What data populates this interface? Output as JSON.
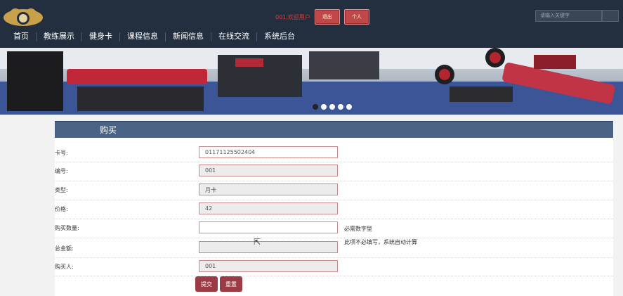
{
  "header": {
    "user_text": "001,欢迎用户",
    "btn1": "退出",
    "btn2": "个人",
    "search_placeholder": "请输入关键字"
  },
  "nav": [
    "首页",
    "教练展示",
    "健身卡",
    "课程信息",
    "新闻信息",
    "在线交流",
    "系统后台"
  ],
  "banner": {
    "slides": 5,
    "active": 0
  },
  "form": {
    "title": "购买",
    "rows": [
      {
        "label": "卡号:",
        "value": "01171125502404",
        "readonly": false,
        "hint": ""
      },
      {
        "label": "编号:",
        "value": "001",
        "readonly": true,
        "hint": ""
      },
      {
        "label": "类型:",
        "value": "月卡",
        "readonly": true,
        "hint": ""
      },
      {
        "label": "价格:",
        "value": "42",
        "readonly": true,
        "hint": ""
      },
      {
        "label": "购买数量:",
        "value": "",
        "readonly": false,
        "hint": "必需数字型"
      },
      {
        "label": "总金额:",
        "value": "",
        "readonly": true,
        "hint": "此项不必填写，系统自动计算"
      },
      {
        "label": "购买人:",
        "value": "001",
        "readonly": true,
        "hint": ""
      }
    ],
    "submit": "提交",
    "reset": "重置"
  },
  "colors": {
    "header_bg": "#232f3e",
    "panel_head": "#4a6284",
    "button": "#9b3b45"
  }
}
